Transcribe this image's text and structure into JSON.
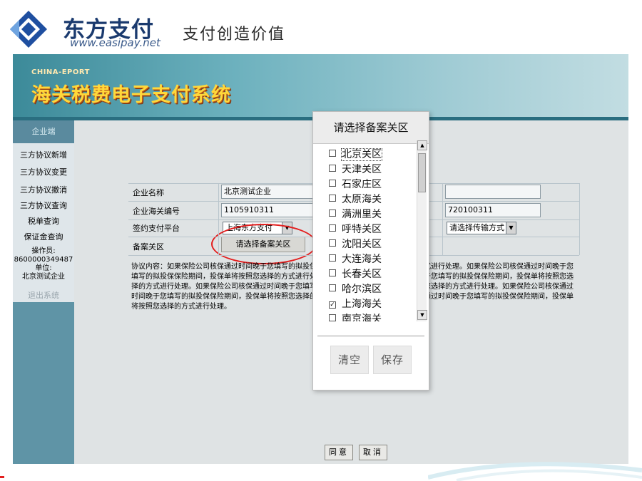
{
  "brand": {
    "name": "东方支付",
    "url": "www.easipay.net",
    "slogan": "支付创造价值"
  },
  "banner": {
    "en": "CHINA-EPORT",
    "title": "海关税费电子支付系统"
  },
  "nav": {
    "head": "企业端",
    "items": [
      "三方协议新增",
      "三方协议变更",
      "三方协议撤消",
      "三方协议查询",
      "税单查询",
      "保证金查询"
    ],
    "operator_label": "操作员:",
    "operator_id": "8600000349487",
    "unit_label": "单位:",
    "unit_name": "北京测试企业",
    "logout": "退出系统"
  },
  "form": {
    "company_name_label": "企业名称",
    "company_name_value": "北京测试企业",
    "customs_code_label": "企业海关编号",
    "customs_code_value": "1105910311",
    "right_code_value": "720100311",
    "platform_label": "签约支付平台",
    "platform_value": "上海东方支付",
    "transfer_select": "请选择传输方式",
    "filing_label": "备案关区",
    "filing_button": "请选择备案关区"
  },
  "agreement": {
    "text": "协议内容：如果保险公司核保通过时间晚于您填写的拟投保险期间，投保单将按照您选择的方式进行处理。如果保险公司核保通过时间晚于您填写的拟投保保险期间，投保单将按照您选择的方式进行处理。如果保险公司核保通过时间晚于您填写的拟投保保险期间，投保单将按照您选择的方式进行处理。如果保险公司核保通过时间晚于您填写的拟投保保险期间，投保单将按照您选择的方式进行处理。如果保险公司核保通过时间晚于您填写的拟投保保险期间，投保单将按照您选择的方式进行处理。如果保险公司核保通过时间晚于您填写的拟投保保险期间，投保单将按照您选择的方式进行处理。"
  },
  "buttons": {
    "agree": "同意",
    "cancel": "取消"
  },
  "popup": {
    "title": "请选择备案关区",
    "options": [
      {
        "label": "北京关区",
        "checked": false
      },
      {
        "label": "天津关区",
        "checked": false
      },
      {
        "label": "石家庄区",
        "checked": false
      },
      {
        "label": "太原海关",
        "checked": false
      },
      {
        "label": "满洲里关",
        "checked": false
      },
      {
        "label": "呼特关区",
        "checked": false
      },
      {
        "label": "沈阳关区",
        "checked": false
      },
      {
        "label": "大连海关",
        "checked": false
      },
      {
        "label": "长春关区",
        "checked": false
      },
      {
        "label": "哈尔滨区",
        "checked": false
      },
      {
        "label": "上海海关",
        "checked": true
      },
      {
        "label": "南京海关",
        "checked": false
      }
    ],
    "clear": "清空",
    "save": "保存"
  },
  "colors": {
    "accent_red": "#e31e1e",
    "banner_teal": "#3c8a99",
    "title_yellow": "#ffd83a",
    "brand_navy": "#1a3a6e"
  }
}
